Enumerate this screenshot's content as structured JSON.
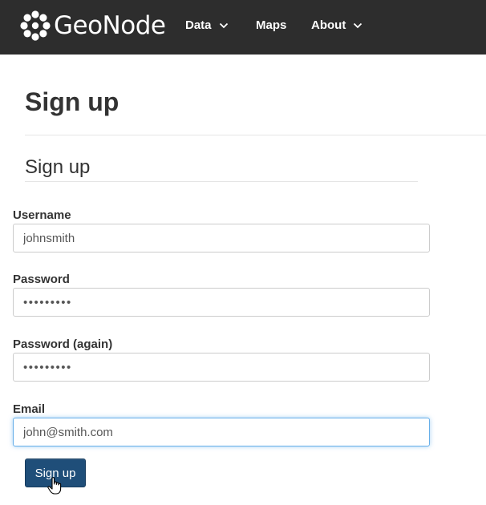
{
  "navbar": {
    "brand": "GeoNode",
    "items": [
      {
        "label": "Data",
        "has_dropdown": true
      },
      {
        "label": "Maps",
        "has_dropdown": false
      },
      {
        "label": "About",
        "has_dropdown": true
      }
    ],
    "background_color": "#2d2d2d"
  },
  "main": {
    "page_title": "Sign up",
    "section_title": "Sign up",
    "fields": [
      {
        "label": "Username",
        "value": "johnsmith",
        "type": "text"
      },
      {
        "label": "Password",
        "value": "•••••••••",
        "type": "password"
      },
      {
        "label": "Password (again)",
        "value": "•••••••••",
        "type": "password"
      },
      {
        "label": "Email",
        "value": "john@smith.com",
        "type": "email",
        "focused": true
      }
    ],
    "submit_label": "Sign up",
    "submit_color": "#1f4e79"
  }
}
